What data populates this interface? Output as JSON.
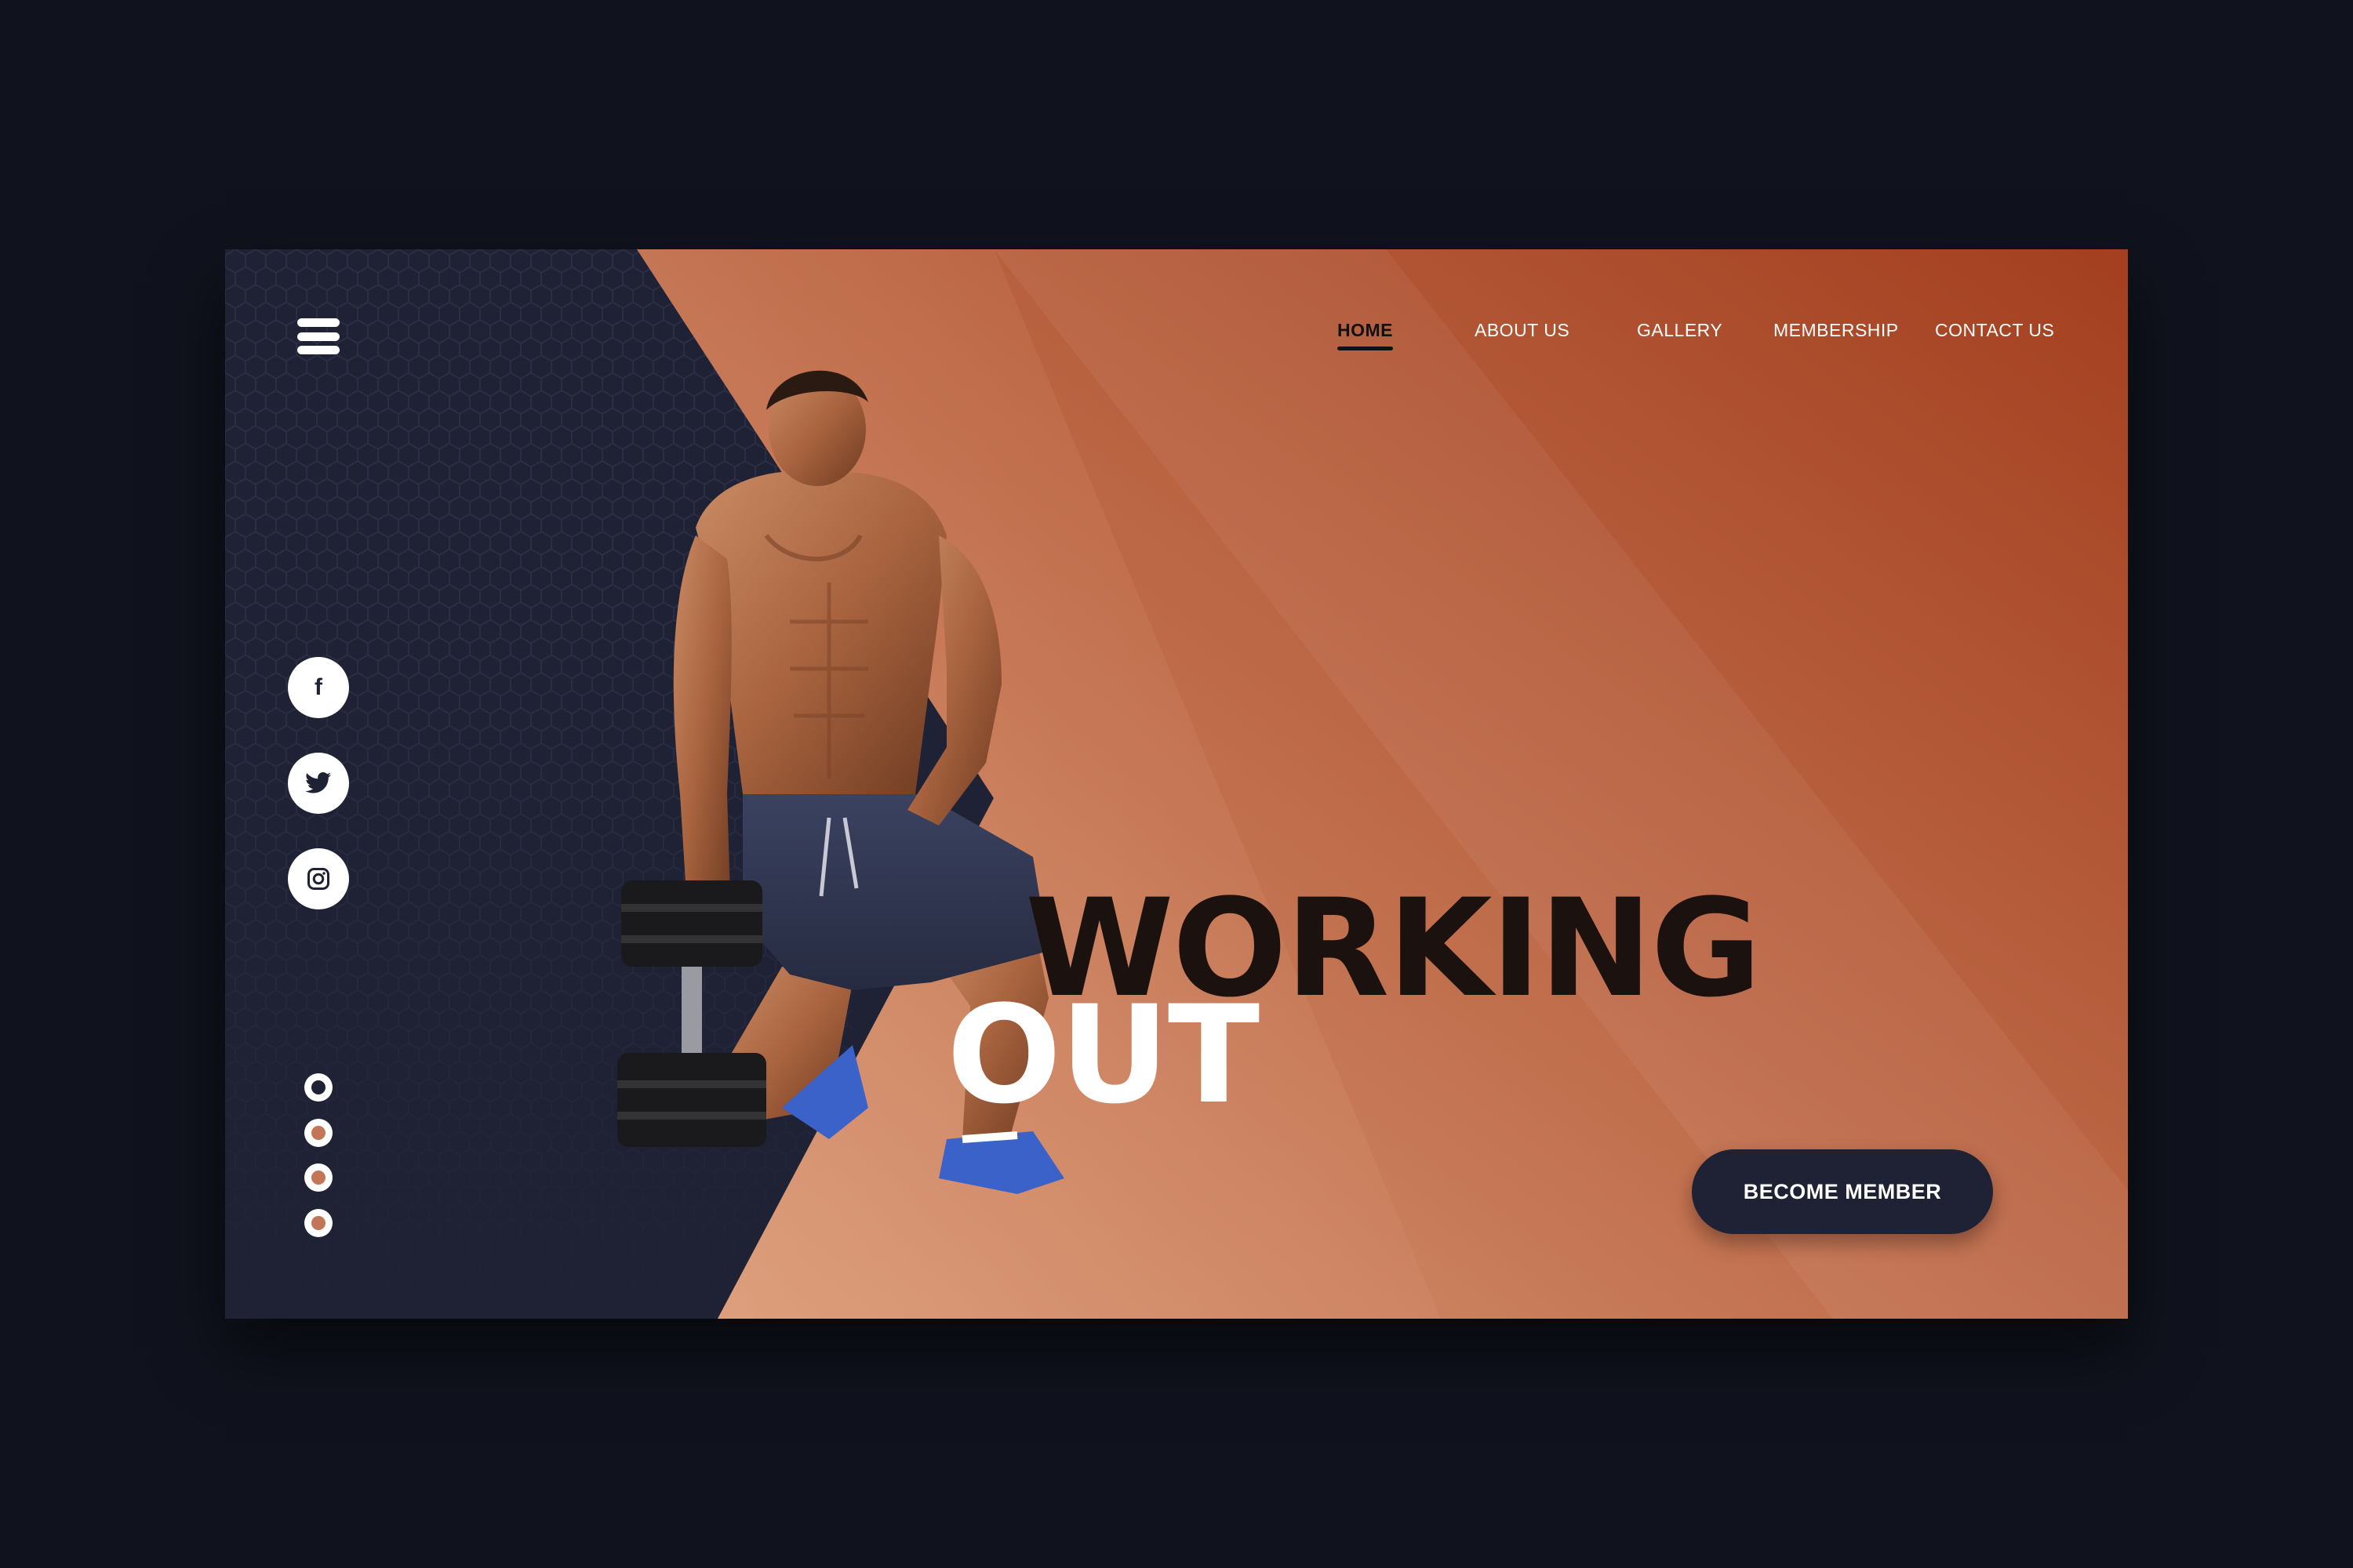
{
  "nav": {
    "items": [
      {
        "label": "HOME",
        "active": true
      },
      {
        "label": "ABOUT US",
        "active": false
      },
      {
        "label": "GALLERY",
        "active": false
      },
      {
        "label": "MEMBERSHIP",
        "active": false
      },
      {
        "label": "CONTACT US",
        "active": false
      }
    ]
  },
  "social": [
    {
      "name": "facebook-icon",
      "glyph": "f"
    },
    {
      "name": "twitter-icon"
    },
    {
      "name": "instagram-icon"
    }
  ],
  "pager": {
    "count": 4,
    "active_index": 0
  },
  "hero": {
    "headline_line1": "WORKING",
    "headline_line2": "OUT"
  },
  "cta": {
    "label": "BECOME MEMBER"
  },
  "colors": {
    "page_bg": "#10131d",
    "navy": "#1f2234",
    "accent_light": "#d99a78",
    "accent_dark": "#a33f1f",
    "headline_dark": "#1b1210"
  }
}
